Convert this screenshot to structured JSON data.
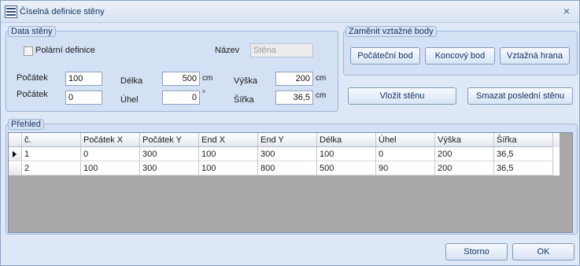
{
  "window": {
    "title": "Číselná definice stěny",
    "close": "×"
  },
  "data_steny": {
    "label": "Data stěny",
    "polar_label": "Polární definice",
    "polar_checked": false,
    "nazev_label": "Název",
    "nazev_value": "Stěna",
    "pocatek1_label": "Počátek",
    "pocatek1_value": "100",
    "pocatek2_label": "Počátek",
    "pocatek2_value": "0",
    "delka_label": "Délka",
    "delka_value": "500",
    "delka_unit": "cm",
    "uhel_label": "Úhel",
    "uhel_value": "0",
    "uhel_unit": "°",
    "vyska_label": "Výška",
    "vyska_value": "200",
    "vyska_unit": "cm",
    "sirka_label": "Šířka",
    "sirka_value": "36,5",
    "sirka_unit": "cm"
  },
  "zamenit": {
    "label": "Zaměnit vztažné body",
    "btn_pocatecni": "Počáteční bod",
    "btn_koncovy": "Koncový bod",
    "btn_vztazna": "Vztažná hrana"
  },
  "actions": {
    "vlozit": "Vložit stěnu",
    "smazat": "Smazat poslední stěnu"
  },
  "prehled": {
    "label": "Přehled",
    "columns": [
      "č.",
      "Počátek X",
      "Počátek Y",
      "End X",
      "End Y",
      "Délka",
      "Úhel",
      "Výška",
      "Šířka"
    ],
    "rows": [
      [
        "1",
        "0",
        "300",
        "100",
        "300",
        "100",
        "0",
        "200",
        "36,5"
      ],
      [
        "2",
        "100",
        "300",
        "100",
        "800",
        "500",
        "90",
        "200",
        "36,5"
      ]
    ]
  },
  "footer": {
    "storno": "Storno",
    "ok": "OK"
  }
}
